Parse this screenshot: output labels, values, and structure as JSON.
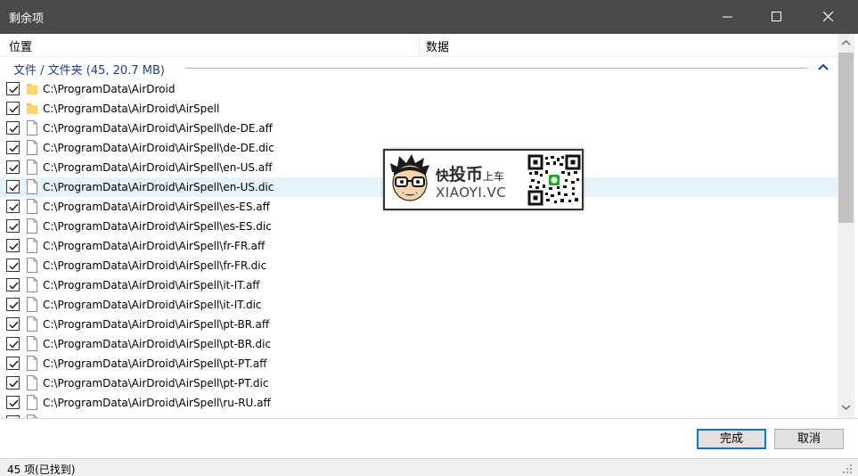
{
  "window": {
    "title": "剩余项"
  },
  "columns": {
    "location": "位置",
    "data": "数据"
  },
  "group": {
    "title": "文件 / 文件夹 (45, 20.7 MB)"
  },
  "items": [
    {
      "type": "folder",
      "checked": true,
      "path": "C:\\ProgramData\\AirDroid"
    },
    {
      "type": "folder",
      "checked": true,
      "path": "C:\\ProgramData\\AirDroid\\AirSpell"
    },
    {
      "type": "file",
      "checked": true,
      "path": "C:\\ProgramData\\AirDroid\\AirSpell\\de-DE.aff"
    },
    {
      "type": "file",
      "checked": true,
      "path": "C:\\ProgramData\\AirDroid\\AirSpell\\de-DE.dic"
    },
    {
      "type": "file",
      "checked": true,
      "path": "C:\\ProgramData\\AirDroid\\AirSpell\\en-US.aff"
    },
    {
      "type": "file",
      "checked": true,
      "selected": true,
      "path": "C:\\ProgramData\\AirDroid\\AirSpell\\en-US.dic"
    },
    {
      "type": "file",
      "checked": true,
      "path": "C:\\ProgramData\\AirDroid\\AirSpell\\es-ES.aff"
    },
    {
      "type": "file",
      "checked": true,
      "path": "C:\\ProgramData\\AirDroid\\AirSpell\\es-ES.dic"
    },
    {
      "type": "file",
      "checked": true,
      "path": "C:\\ProgramData\\AirDroid\\AirSpell\\fr-FR.aff"
    },
    {
      "type": "file",
      "checked": true,
      "path": "C:\\ProgramData\\AirDroid\\AirSpell\\fr-FR.dic"
    },
    {
      "type": "file",
      "checked": true,
      "path": "C:\\ProgramData\\AirDroid\\AirSpell\\it-IT.aff"
    },
    {
      "type": "file",
      "checked": true,
      "path": "C:\\ProgramData\\AirDroid\\AirSpell\\it-IT.dic"
    },
    {
      "type": "file",
      "checked": true,
      "path": "C:\\ProgramData\\AirDroid\\AirSpell\\pt-BR.aff"
    },
    {
      "type": "file",
      "checked": true,
      "path": "C:\\ProgramData\\AirDroid\\AirSpell\\pt-BR.dic"
    },
    {
      "type": "file",
      "checked": true,
      "path": "C:\\ProgramData\\AirDroid\\AirSpell\\pt-PT.aff"
    },
    {
      "type": "file",
      "checked": true,
      "path": "C:\\ProgramData\\AirDroid\\AirSpell\\pt-PT.dic"
    },
    {
      "type": "file",
      "checked": true,
      "path": "C:\\ProgramData\\AirDroid\\AirSpell\\ru-RU.aff"
    },
    {
      "type": "file",
      "checked": true,
      "path": ""
    }
  ],
  "buttons": {
    "done": "完成",
    "cancel": "取消"
  },
  "status": {
    "text": "45 项(已找到)"
  },
  "watermark": {
    "line1_a": "快",
    "line1_b": "投币",
    "line1_c": "上车",
    "line2": "XIAOYI.VC"
  },
  "colors": {
    "titlebar": "#4a4a4a",
    "group_title": "#1e3f8a",
    "selected_row": "#e5f3fb",
    "primary_border": "#0078d7"
  }
}
